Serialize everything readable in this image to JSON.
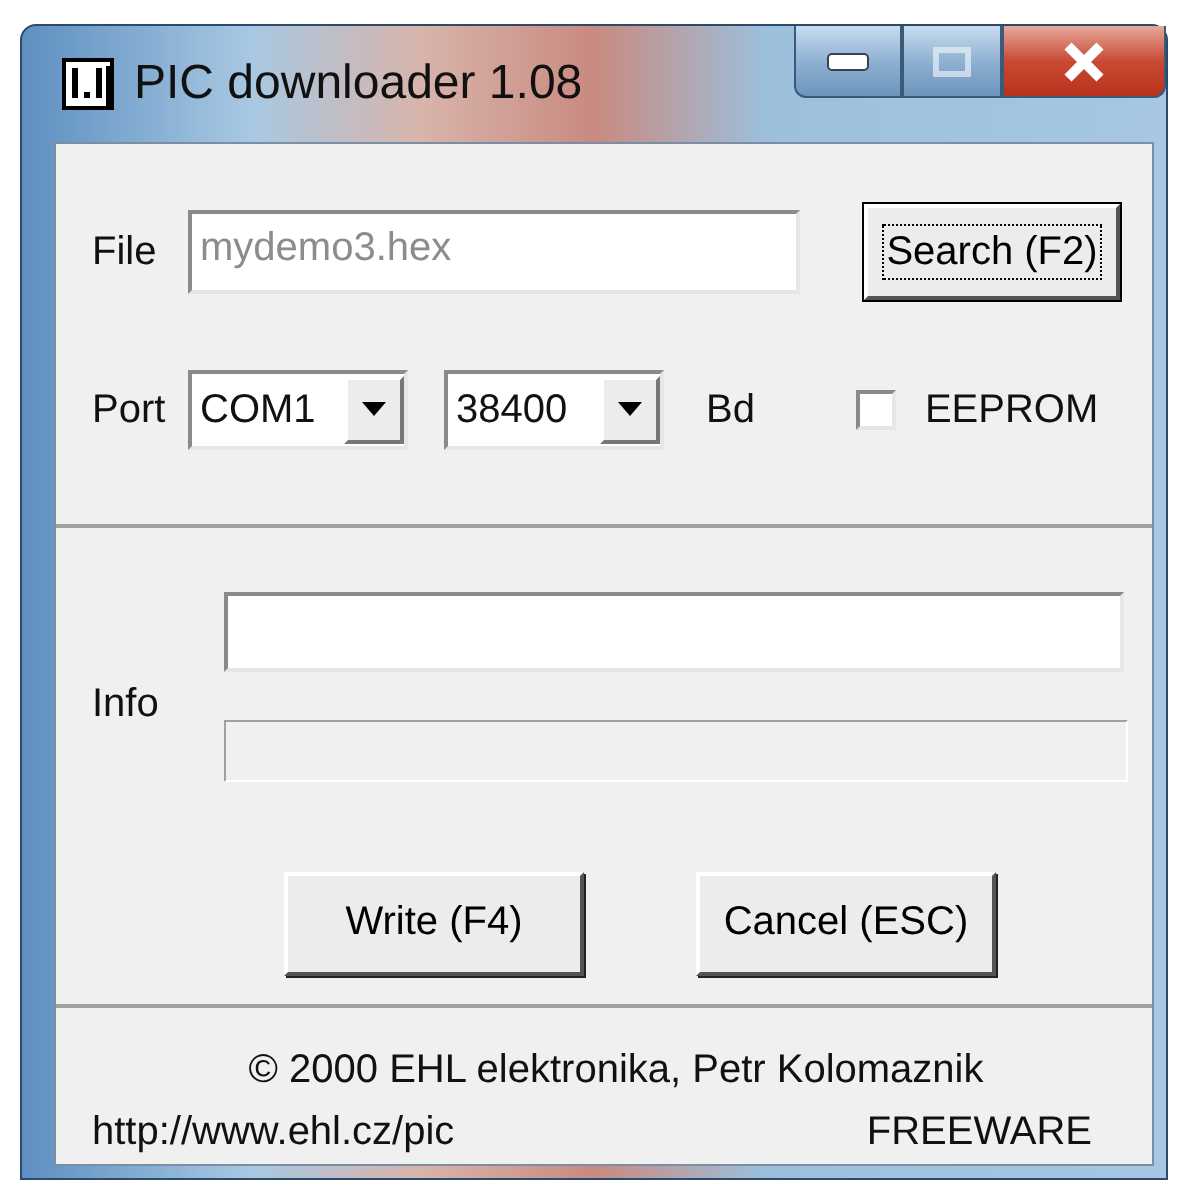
{
  "window": {
    "title": "PIC downloader 1.08"
  },
  "file": {
    "label": "File",
    "value": "mydemo3.hex",
    "disabled": true
  },
  "search_button": {
    "label": "Search (F2)",
    "focused": true
  },
  "port": {
    "label": "Port",
    "port_value": "COM1",
    "baud_value": "38400",
    "baud_unit": "Bd"
  },
  "eeprom": {
    "label": "EEPROM",
    "checked": false
  },
  "info": {
    "label": "Info",
    "progress": {
      "level": 0
    }
  },
  "buttons": [
    {
      "label": "Write (F4)"
    },
    {
      "label": "Cancel (ESC)"
    }
  ],
  "footer": {
    "copyright": "© 2000 EHL elektronika, Petr Kolomaznik",
    "url": "http://www.ehl.cz/pic",
    "license": "FREEWARE"
  }
}
